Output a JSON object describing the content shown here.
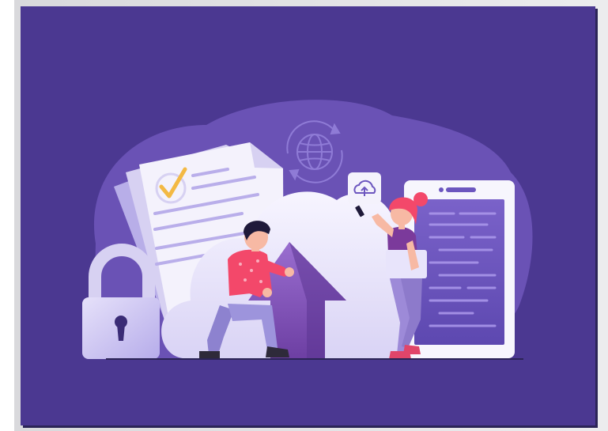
{
  "illustration": {
    "subject": "cloud-upload-security",
    "colors": {
      "background": "#4b3891",
      "blob": "#6a52b5",
      "cloud": "#ece9fb",
      "arrow": "#8a62c4",
      "lock": "#d7d1f2",
      "document": "#f4f2fc",
      "checkmark": "#f3b944",
      "tablet": "#f7f6fd",
      "tablet_screen": "#6c56bf",
      "man_shirt": "#f3486a",
      "man_pants": "#8d82cf",
      "woman_hair": "#f3486a",
      "woman_top": "#7b3a9b",
      "woman_pants": "#9d8ad8"
    }
  }
}
